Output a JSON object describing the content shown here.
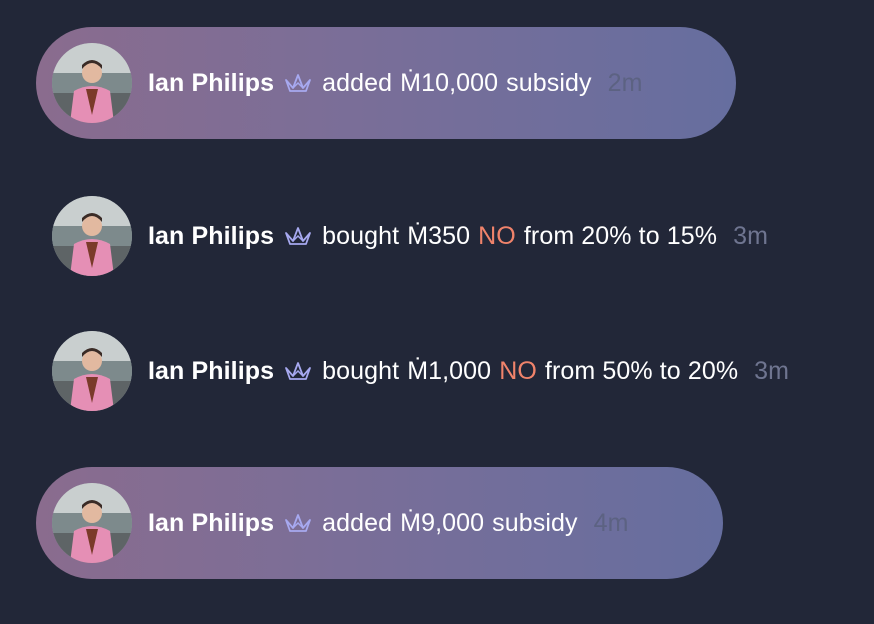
{
  "feed": {
    "items": [
      {
        "user": "Ian Philips",
        "badge_icon": "crane-icon",
        "action": "added",
        "amount": "Ṁ10,000",
        "rest": "subsidy",
        "time": "2m",
        "highlighted": true
      },
      {
        "user": "Ian Philips",
        "badge_icon": "crane-icon",
        "action": "bought",
        "amount": "Ṁ350",
        "outcome": "NO",
        "rest": "from 20% to 15%",
        "time": "3m",
        "highlighted": false
      },
      {
        "user": "Ian Philips",
        "badge_icon": "crane-icon",
        "action": "bought",
        "amount": "Ṁ1,000",
        "outcome": "NO",
        "rest": "from 50% to 20%",
        "time": "3m",
        "highlighted": false
      },
      {
        "user": "Ian Philips",
        "badge_icon": "crane-icon",
        "action": "added",
        "amount": "Ṁ9,000",
        "rest": "subsidy",
        "time": "4m",
        "highlighted": true
      }
    ]
  },
  "colors": {
    "background": "#222738",
    "no_outcome": "#f0836b",
    "timestamp": "#6f7590",
    "badge": "#a7a9f0"
  }
}
